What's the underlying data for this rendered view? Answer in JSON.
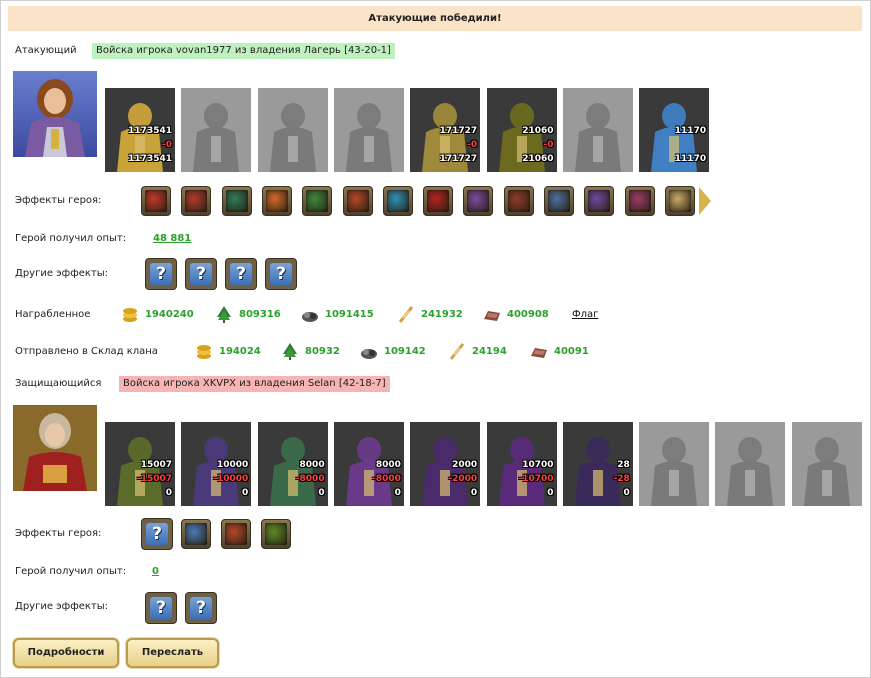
{
  "banner": "Атакующие победили!",
  "attacker": {
    "label": "Атакующий",
    "army": "Войска игрока vovan1977 из владения Лагерь [43-20-1]",
    "units": [
      {
        "name": "unit-1",
        "top": "1173541",
        "mid": "-0",
        "bottom": "1173541",
        "tint": "#c9a23a",
        "alive": true
      },
      {
        "name": "unit-2",
        "top": "",
        "mid": "",
        "bottom": "",
        "tint": "#8a8a8a",
        "alive": false
      },
      {
        "name": "unit-3",
        "top": "",
        "mid": "",
        "bottom": "",
        "tint": "#8a8a8a",
        "alive": false
      },
      {
        "name": "unit-4",
        "top": "",
        "mid": "",
        "bottom": "",
        "tint": "#8a8a8a",
        "alive": false
      },
      {
        "name": "unit-5",
        "top": "171727",
        "mid": "-0",
        "bottom": "171727",
        "tint": "#9e8a3a",
        "alive": true
      },
      {
        "name": "unit-6",
        "top": "21060",
        "mid": "-0",
        "bottom": "21060",
        "tint": "#6b6a1e",
        "alive": true
      },
      {
        "name": "unit-7",
        "top": "",
        "mid": "",
        "bottom": "",
        "tint": "#707070",
        "alive": false
      },
      {
        "name": "unit-8",
        "top": "11170",
        "mid": "",
        "bottom": "11170",
        "tint": "#3f7fc2",
        "alive": true
      }
    ],
    "effects_label": "Эффекты героя:",
    "effects": [
      "#c0392b",
      "#b03a2e",
      "#2f7a5a",
      "#d06a2a",
      "#3a8a3a",
      "#b5462a",
      "#2e8fb5",
      "#b22222",
      "#7a4aa0",
      "#8e3a2a",
      "#4b6fa0",
      "#6a4aa0",
      "#9a3a6a",
      "#c8a86a"
    ],
    "exp_label": "Герой получил опыт:",
    "exp_value": "48 881",
    "other_label": "Другие эффекты:",
    "other": [
      "?",
      "?",
      "?",
      "?"
    ],
    "loot_label": "Награбленное",
    "loot": [
      {
        "icon": "gold-icon",
        "value": "1940240",
        "color": "#d9a21b"
      },
      {
        "icon": "wood-icon",
        "value": "809316",
        "color": "#2e7d32"
      },
      {
        "icon": "ore-icon",
        "value": "1091415",
        "color": "#555555"
      },
      {
        "icon": "grain-icon",
        "value": "241932",
        "color": "#d0a040"
      },
      {
        "icon": "hide-icon",
        "value": "400908",
        "color": "#8a4a3a"
      }
    ],
    "flag_label": "Флаг",
    "clan_label": "Отправлено в Склад клана",
    "clan": [
      {
        "icon": "gold-icon",
        "value": "194024",
        "color": "#d9a21b"
      },
      {
        "icon": "wood-icon",
        "value": "80932",
        "color": "#2e7d32"
      },
      {
        "icon": "ore-icon",
        "value": "109142",
        "color": "#555555"
      },
      {
        "icon": "grain-icon",
        "value": "24194",
        "color": "#d0a040"
      },
      {
        "icon": "hide-icon",
        "value": "40091",
        "color": "#8a4a3a"
      }
    ]
  },
  "defender": {
    "label": "Защищающийся",
    "army": "Войска игрока XKVPX из владения Selan [42-18-7]",
    "units": [
      {
        "name": "unit-1",
        "top": "15007",
        "mid": "-15007",
        "bottom": "0",
        "tint": "#5a6b2a",
        "alive": true
      },
      {
        "name": "unit-2",
        "top": "10000",
        "mid": "-10000",
        "bottom": "0",
        "tint": "#4a3a7a",
        "alive": true
      },
      {
        "name": "unit-3",
        "top": "8000",
        "mid": "-8000",
        "bottom": "0",
        "tint": "#3a6a4a",
        "alive": true
      },
      {
        "name": "unit-4",
        "top": "8000",
        "mid": "-8000",
        "bottom": "0",
        "tint": "#6a3a8a",
        "alive": true
      },
      {
        "name": "unit-5",
        "top": "2000",
        "mid": "-2000",
        "bottom": "0",
        "tint": "#4a2a6a",
        "alive": true
      },
      {
        "name": "unit-6",
        "top": "10700",
        "mid": "-10700",
        "bottom": "0",
        "tint": "#5a2a7a",
        "alive": true
      },
      {
        "name": "unit-7",
        "top": "28",
        "mid": "-28",
        "bottom": "0",
        "tint": "#3a2a5a",
        "alive": true
      },
      {
        "name": "unit-8",
        "top": "",
        "mid": "",
        "bottom": "",
        "tint": "#5a5a5a",
        "alive": false
      },
      {
        "name": "unit-9",
        "top": "",
        "mid": "",
        "bottom": "",
        "tint": "#d6c060",
        "alive": false
      },
      {
        "name": "unit-10",
        "top": "",
        "mid": "",
        "bottom": "",
        "tint": "#d6c060",
        "alive": false
      }
    ],
    "effects_label": "Эффекты героя:",
    "effects": [
      "?",
      "#4a7ab5",
      "#b5472a",
      "#5a8a2a"
    ],
    "exp_label": "Герой получил опыт:",
    "exp_value": "0",
    "other_label": "Другие эффекты:",
    "other": [
      "?",
      "?"
    ]
  },
  "buttons": {
    "details": "Подробности",
    "forward": "Переслать"
  }
}
